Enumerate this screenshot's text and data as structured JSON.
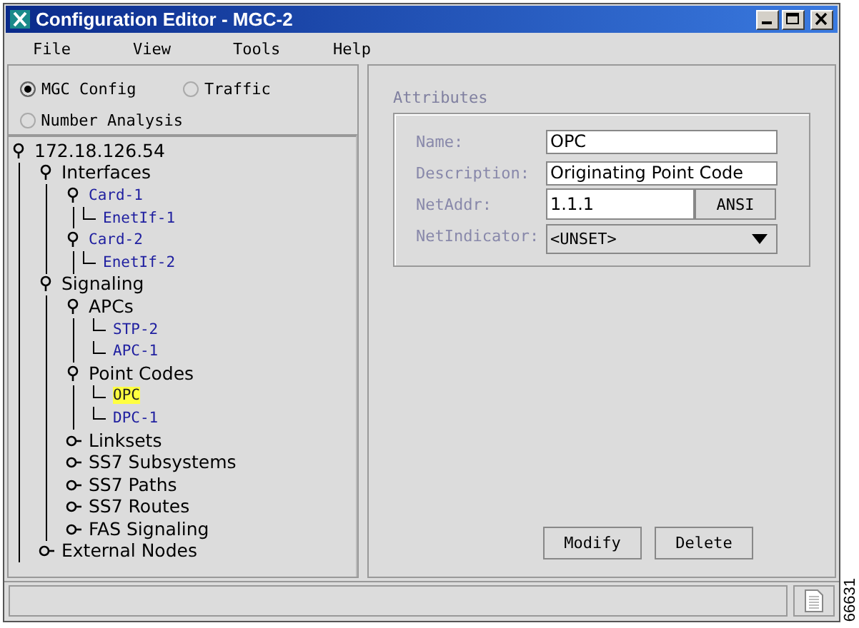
{
  "window": {
    "title": "Configuration Editor - MGC-2"
  },
  "menu": [
    "File",
    "View",
    "Tools",
    "Help"
  ],
  "view_options": [
    {
      "label": "MGC Config",
      "selected": true
    },
    {
      "label": "Traffic",
      "selected": false
    },
    {
      "label": "Number Analysis",
      "selected": false
    }
  ],
  "tree": [
    {
      "label": "172.18.126.54",
      "kind": "node",
      "expanded": true,
      "selected": false,
      "children": [
        {
          "label": "Interfaces",
          "kind": "node",
          "expanded": true,
          "selected": false,
          "children": [
            {
              "label": "Card-1",
              "kind": "group",
              "expanded": true,
              "selected": false,
              "children": [
                {
                  "label": "EnetIf-1",
                  "kind": "leaf",
                  "selected": false
                }
              ]
            },
            {
              "label": "Card-2",
              "kind": "group",
              "expanded": true,
              "selected": false,
              "children": [
                {
                  "label": "EnetIf-2",
                  "kind": "leaf",
                  "selected": false
                }
              ]
            }
          ]
        },
        {
          "label": "Signaling",
          "kind": "node",
          "expanded": true,
          "selected": false,
          "children": [
            {
              "label": "APCs",
              "kind": "node",
              "expanded": true,
              "selected": false,
              "children": [
                {
                  "label": "STP-2",
                  "kind": "leaf",
                  "selected": false
                },
                {
                  "label": "APC-1",
                  "kind": "leaf",
                  "selected": false
                }
              ]
            },
            {
              "label": "Point Codes",
              "kind": "node",
              "expanded": true,
              "selected": false,
              "children": [
                {
                  "label": "OPC",
                  "kind": "leaf",
                  "selected": true
                },
                {
                  "label": "DPC-1",
                  "kind": "leaf",
                  "selected": false
                }
              ]
            },
            {
              "label": "Linksets",
              "kind": "node",
              "expanded": false,
              "selected": false
            },
            {
              "label": "SS7 Subsystems",
              "kind": "node",
              "expanded": false,
              "selected": false
            },
            {
              "label": "SS7 Paths",
              "kind": "node",
              "expanded": false,
              "selected": false
            },
            {
              "label": "SS7 Routes",
              "kind": "node",
              "expanded": false,
              "selected": false
            },
            {
              "label": "FAS Signaling",
              "kind": "node",
              "expanded": false,
              "selected": false
            }
          ]
        },
        {
          "label": "External Nodes",
          "kind": "node",
          "expanded": false,
          "selected": false
        }
      ]
    }
  ],
  "attributes": {
    "title": "Attributes",
    "fields": [
      {
        "label": "Name:",
        "kind": "text",
        "value": "OPC"
      },
      {
        "label": "Description:",
        "kind": "text",
        "value": "Originating Point Code"
      },
      {
        "label": "NetAddr:",
        "kind": "text_button",
        "value": "1.1.1",
        "button": "ANSI"
      },
      {
        "label": "NetIndicator:",
        "kind": "dropdown",
        "value": "<UNSET>"
      }
    ]
  },
  "buttons": [
    "Modify",
    "Delete"
  ],
  "figure_number": "66631"
}
